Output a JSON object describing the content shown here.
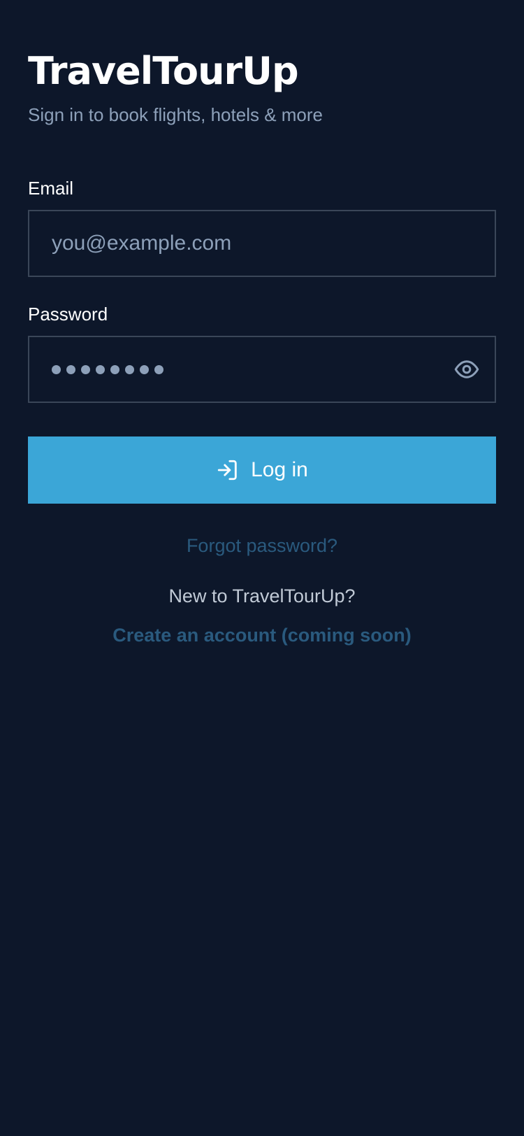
{
  "app": {
    "title": "TravelTourUp",
    "subtitle": "Sign in to book flights, hotels & more"
  },
  "form": {
    "email_label": "Email",
    "email_placeholder": "you@example.com",
    "password_label": "Password",
    "password_masked_length": 8,
    "show_password_icon": "eye-icon",
    "login_icon": "log-in-arrow-icon",
    "login_label": "Log in"
  },
  "links": {
    "forgot_password": "Forgot password?",
    "new_user_prompt": "New to TravelTourUp?",
    "create_account": "Create an account (coming soon)"
  },
  "colors": {
    "background": "#0d172a",
    "primary_button": "#3ba6d7",
    "muted_text": "#8da0b9",
    "link": "#2a5a7e",
    "input_border": "#3a4658"
  }
}
